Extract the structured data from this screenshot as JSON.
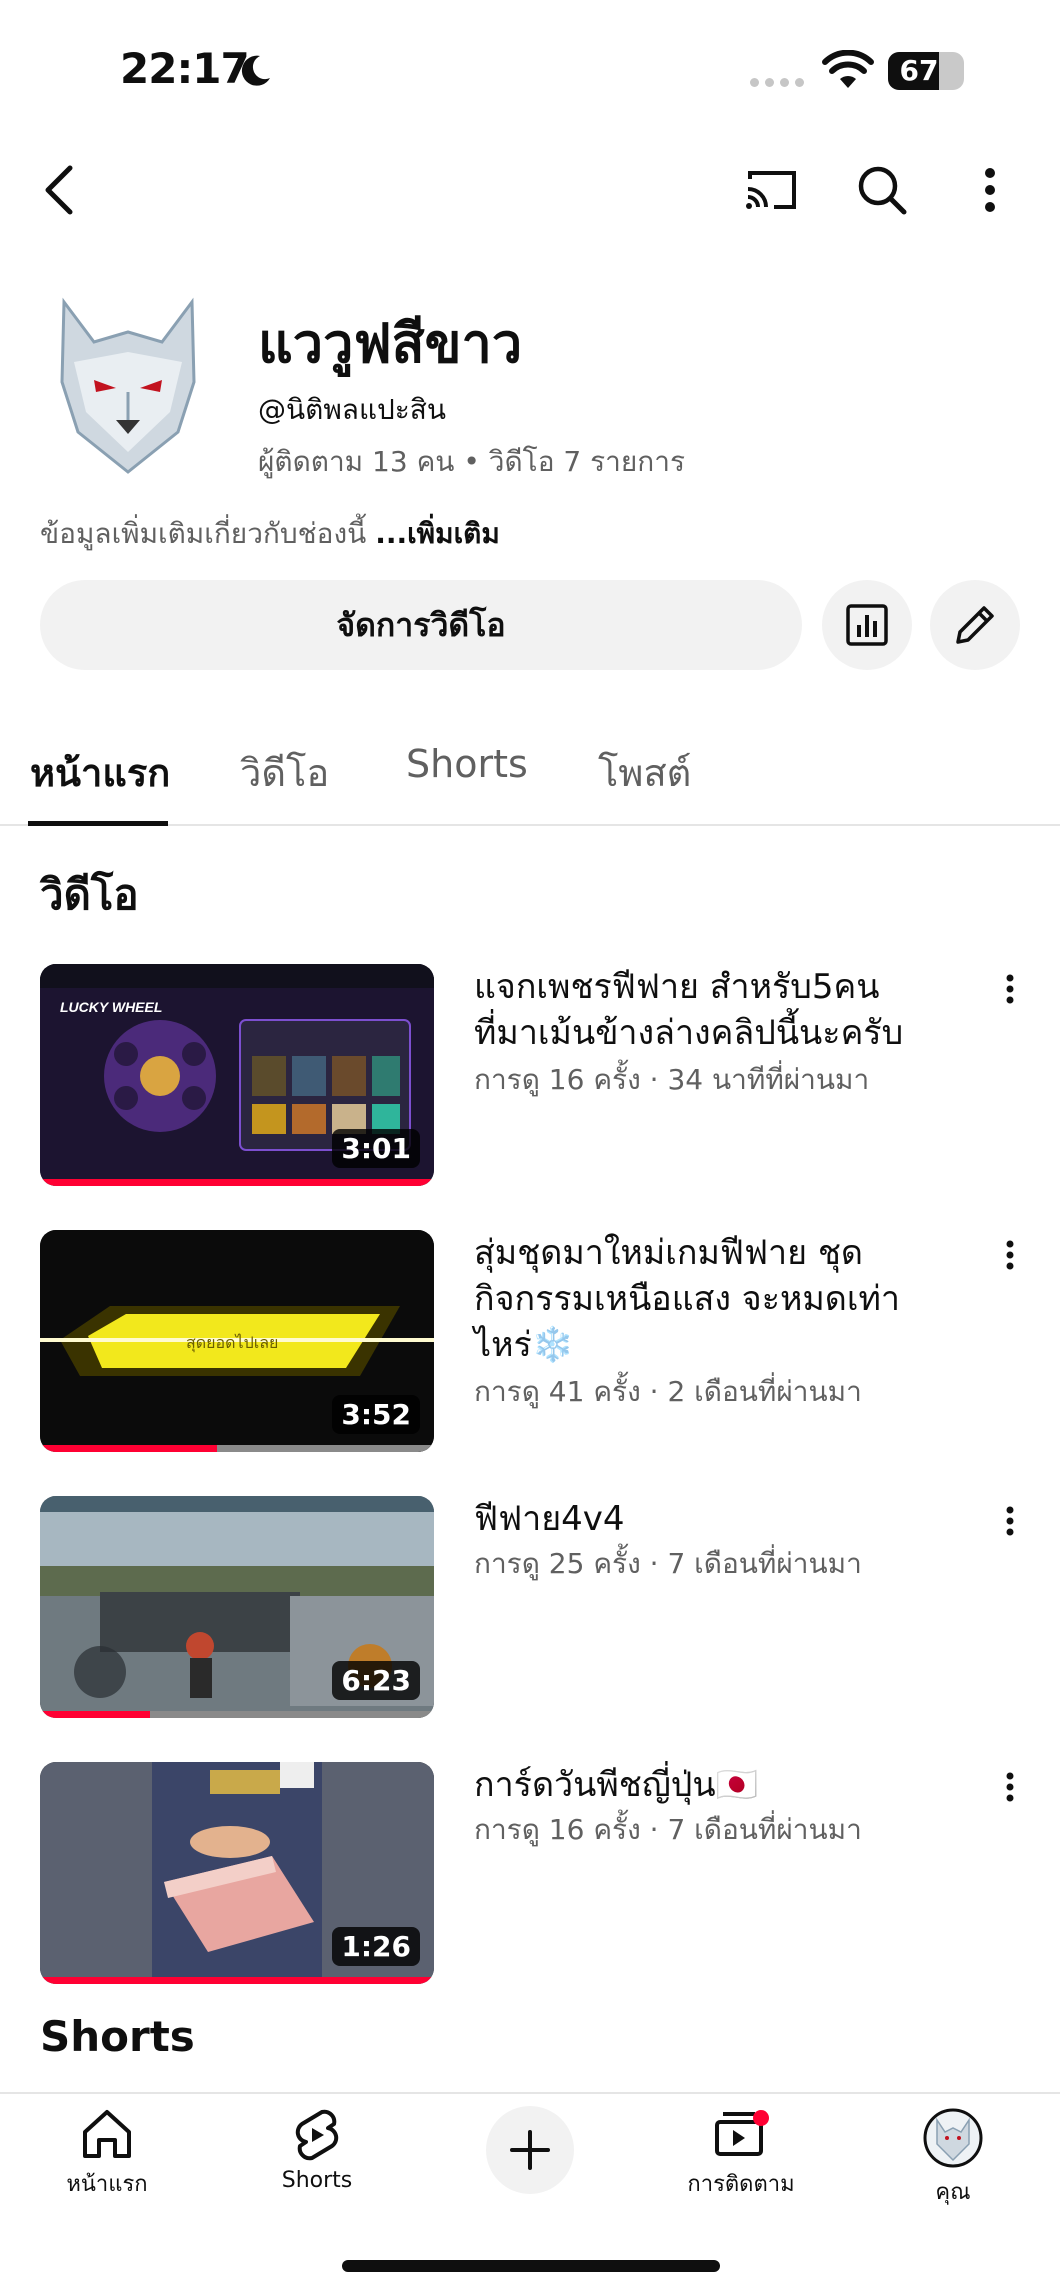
{
  "status_bar": {
    "time": "22:17",
    "battery_level": "67",
    "battery_fraction": 0.67
  },
  "channel": {
    "name": "แววูฟสีขาว",
    "handle": "@นิติพลแปะสิน",
    "stats": "ผู้ติดตาม 13 คน • วิดีโอ 7 รายการ",
    "description": "ข้อมูลเพิ่มเติมเกี่ยวกับช่องนี้",
    "more_label": "...เพิ่มเติม"
  },
  "actions": {
    "manage_videos": "จัดการวิดีโอ"
  },
  "tabs": [
    {
      "label": "หน้าแรก",
      "active": true
    },
    {
      "label": "วิดีโอ",
      "active": false
    },
    {
      "label": "Shorts",
      "active": false
    },
    {
      "label": "โพสต์",
      "active": false
    }
  ],
  "videos_section": {
    "title": "วิดีโอ",
    "items": [
      {
        "title": "แจกเพชรฟีฟาย สำหรับ5คน ที่มาเม้นข้างล่างคลิปนี้นะครับ",
        "meta": "การดู 16 ครั้ง · 34 นาทีที่ผ่านมา",
        "duration": "3:01",
        "watched_fraction": 1.0
      },
      {
        "title": "สุ่มชุดมาใหม่เกมฟีฟาย ชุดกิจกรรมเหนือแสง จะหมดเท่าไหร่❄️",
        "meta": "การดู 41 ครั้ง · 2 เดือนที่ผ่านมา",
        "duration": "3:52",
        "watched_fraction": 0.45
      },
      {
        "title": "ฟีฟาย4v4",
        "meta": "การดู 25 ครั้ง · 7 เดือนที่ผ่านมา",
        "duration": "6:23",
        "watched_fraction": 0.28
      },
      {
        "title": "การ์ดวันพีชญี่ปุ่น🇯🇵",
        "meta": "การดู 16 ครั้ง · 7 เดือนที่ผ่านมา",
        "duration": "1:26",
        "watched_fraction": 1.0
      }
    ]
  },
  "shorts_section": {
    "title": "Shorts"
  },
  "bottom_nav": {
    "home": "หน้าแรก",
    "shorts": "Shorts",
    "subscriptions": "การติดตาม",
    "you": "คุณ"
  },
  "colors": {
    "accent_red": "#ff0033",
    "text_primary": "#0f0f0f",
    "text_secondary": "#606060",
    "chip_bg": "#f2f2f2"
  }
}
